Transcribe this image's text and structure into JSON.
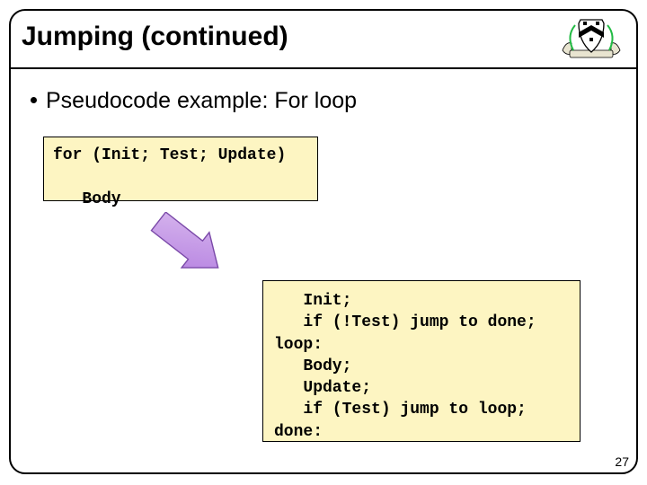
{
  "title": "Jumping (continued)",
  "bullet": "Pseudocode example: For loop",
  "code_top": "for (Init; Test; Update)\n\n   Body",
  "code_bottom": "   Init;\n   if (!Test) jump to done;\nloop:\n   Body;\n   Update;\n   if (Test) jump to loop;\ndone:",
  "page_number": "27",
  "crest_alt": "university crest"
}
